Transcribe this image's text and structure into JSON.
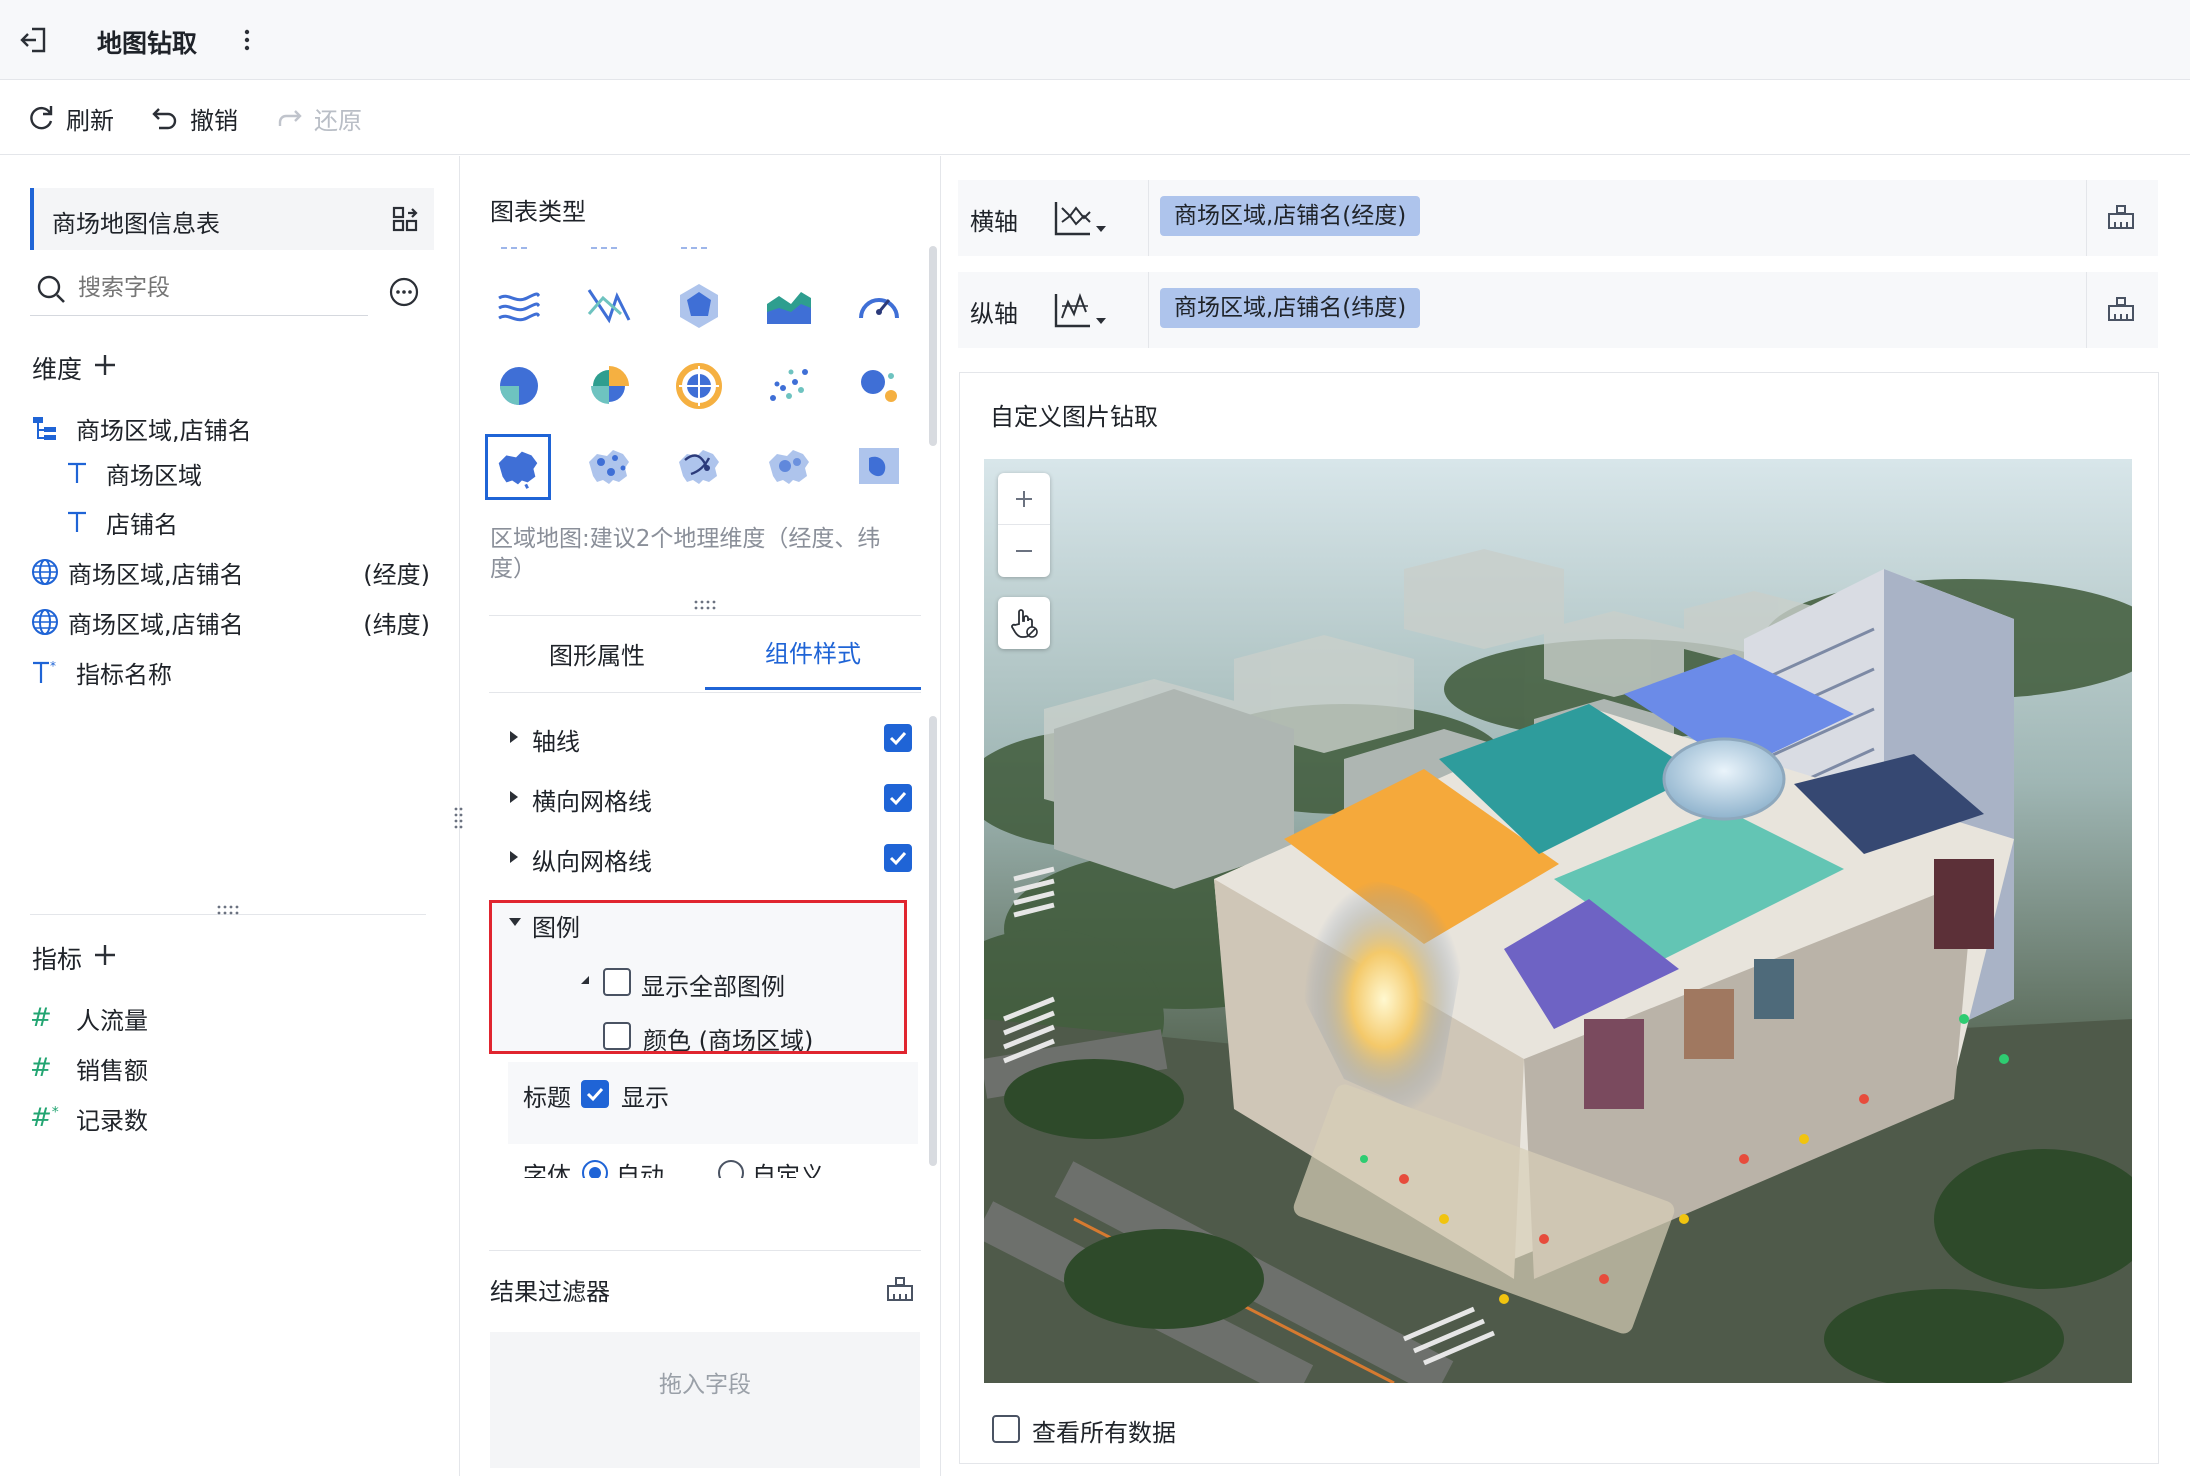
{
  "window": {
    "title": "地图钻取"
  },
  "toolbar": {
    "refresh": "刷新",
    "undo": "撤销",
    "redo": "还原"
  },
  "dataset": {
    "name": "商场地图信息表",
    "search_placeholder": "搜索字段"
  },
  "dimensions": {
    "label": "维度",
    "items": [
      {
        "name": "商场区域,店铺名",
        "icon": "hierarchy-icon"
      },
      {
        "name": "商场区域",
        "icon": "text-field-icon"
      },
      {
        "name": "店铺名",
        "icon": "text-field-icon"
      },
      {
        "name": "商场区域,店铺名",
        "suffix": "(经度)",
        "icon": "globe-icon"
      },
      {
        "name": "商场区域,店铺名",
        "suffix": "(纬度)",
        "icon": "globe-icon"
      },
      {
        "name": "指标名称",
        "icon": "text-calc-icon"
      }
    ]
  },
  "measures": {
    "label": "指标",
    "items": [
      {
        "name": "人流量",
        "icon": "number-icon"
      },
      {
        "name": "销售额",
        "icon": "number-icon"
      },
      {
        "name": "记录数",
        "icon": "number-calc-icon"
      }
    ]
  },
  "chart_types": {
    "label": "图表类型",
    "hint": "区域地图:建议2个地理维度（经度、纬度）",
    "selected": "region-map"
  },
  "property_tabs": [
    {
      "label": "图形属性",
      "active": false
    },
    {
      "label": "组件样式",
      "active": true
    }
  ],
  "style_items": [
    {
      "label": "轴线",
      "checked": true
    },
    {
      "label": "横向网格线",
      "checked": true
    },
    {
      "label": "纵向网格线",
      "checked": true
    }
  ],
  "legend": {
    "label": "图例",
    "show_all": "显示全部图例",
    "color_item": "颜色 (商场区域)",
    "show_all_checked": false,
    "color_checked": false
  },
  "title_opt": {
    "label": "标题",
    "show": "显示",
    "checked": true
  },
  "font_opt": {
    "label": "字体",
    "auto": "自动",
    "custom": "自定义"
  },
  "result_filter": {
    "label": "结果过滤器",
    "placeholder": "拖入字段"
  },
  "axes": {
    "x_label": "横轴",
    "x_field": "商场区域,店铺名(经度)",
    "y_label": "纵轴",
    "y_field": "商场区域,店铺名(纬度)"
  },
  "canvas": {
    "title": "自定义图片钻取",
    "view_all": "查看所有数据"
  },
  "colors": {
    "accent": "#1f64d6",
    "highlight": "#e0252f",
    "pill": "#aec4ec",
    "measure": "#23a572"
  }
}
